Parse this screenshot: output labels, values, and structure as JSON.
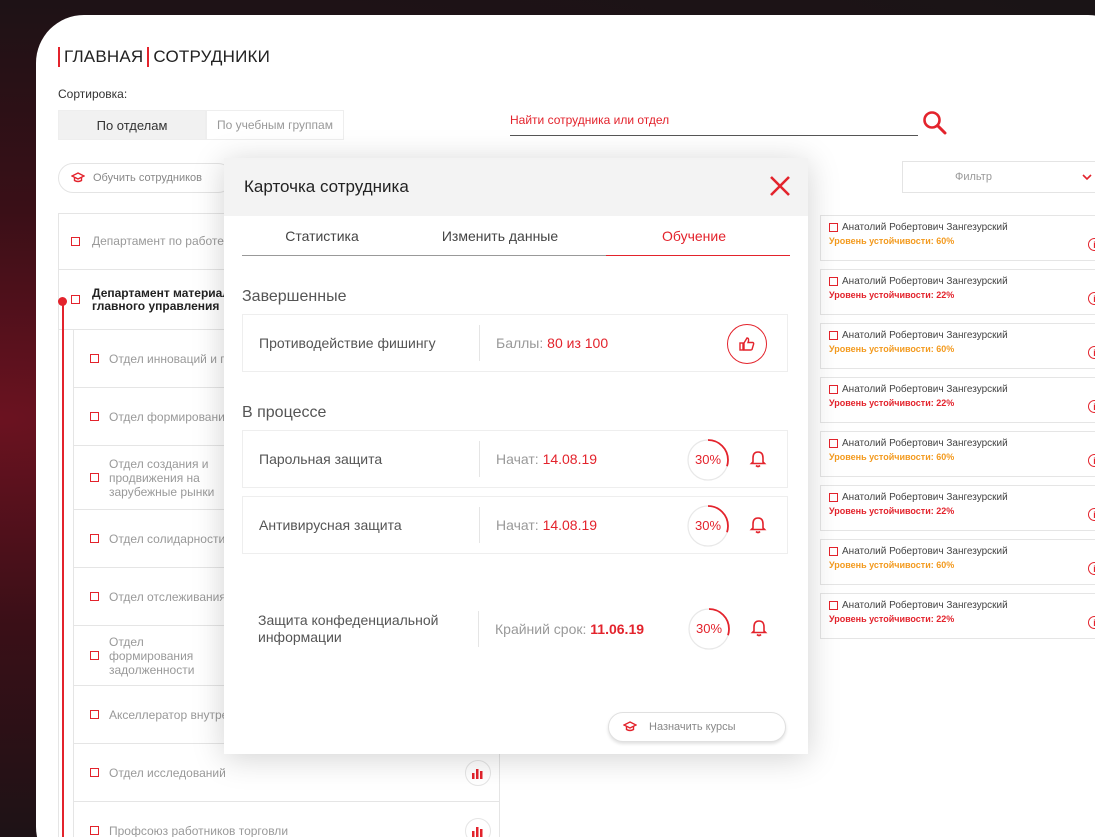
{
  "breadcrumb": {
    "home": "ГЛАВНАЯ",
    "current": "СОТРУДНИКИ"
  },
  "sort": {
    "label": "Сортировка:",
    "by_department": "По отделам",
    "by_group": "По учебным группам"
  },
  "search": {
    "placeholder": "Найти сотрудника или отдел"
  },
  "train_button": "Обучить сотрудников",
  "filter": {
    "label": "Фильтр"
  },
  "departments": {
    "top1": "Департамент по работе с органами и муниципальными",
    "top2": "Департамент материально-технического государственного заказа главного управления",
    "sub": [
      "Отдел инноваций и планирования",
      "Отдел формирования отчетности",
      "Отдел создания и продвижения на зарубежные рынки",
      "Отдел солидарности",
      "Отдел отслеживания",
      "Отдел формирования задолженности",
      "Акселлератор внутренних проектов",
      "Отдел исследований",
      "Профсоюз работников торговли"
    ]
  },
  "employees": [
    {
      "name": "Анатолий Робертович Зангезурский",
      "level": "Уровень устойчивости: 60%",
      "level_color": "#f39a1e"
    },
    {
      "name": "Анатолий Робертович Зангезурский",
      "level": "Уровень устойчивости: 22%",
      "level_color": "#e3232c"
    },
    {
      "name": "Анатолий Робертович Зангезурский",
      "level": "Уровень устойчивости: 60%",
      "level_color": "#f39a1e"
    },
    {
      "name": "Анатолий Робертович Зангезурский",
      "level": "Уровень устойчивости: 22%",
      "level_color": "#e3232c"
    },
    {
      "name": "Анатолий Робертович Зангезурский",
      "level": "Уровень устойчивости: 60%",
      "level_color": "#f39a1e"
    },
    {
      "name": "Анатолий Робертович Зангезурский",
      "level": "Уровень устойчивости: 22%",
      "level_color": "#e3232c"
    },
    {
      "name": "Анатолий Робертович Зангезурский",
      "level": "Уровень устойчивости: 60%",
      "level_color": "#f39a1e"
    },
    {
      "name": "Анатолий Робертович Зангезурский",
      "level": "Уровень устойчивости: 22%",
      "level_color": "#e3232c"
    }
  ],
  "modal": {
    "title": "Карточка сотрудника",
    "tabs": [
      "Статистика",
      "Изменить данные",
      "Обучение"
    ],
    "completed_title": "Завершенные",
    "completed": {
      "name": "Противодействие фишингу",
      "score_label": "Баллы:",
      "score_value": "80 из 100"
    },
    "in_progress_title": "В процессе",
    "in_progress": [
      {
        "name": "Парольная защита",
        "label": "Начат:",
        "value": "14.08.19",
        "percent": "30%",
        "progress": 30
      },
      {
        "name": "Антивирусная защита",
        "label": "Начат:",
        "value": "14.08.19",
        "percent": "30%",
        "progress": 30
      },
      {
        "name": "Защита конфеденциальной информации",
        "label": "Крайний срок:",
        "value": "11.06.19",
        "percent": "30%",
        "progress": 30
      }
    ],
    "assign_button": "Назначить курсы"
  },
  "colors": {
    "accent": "#e3232c",
    "warning": "#f39a1e"
  }
}
